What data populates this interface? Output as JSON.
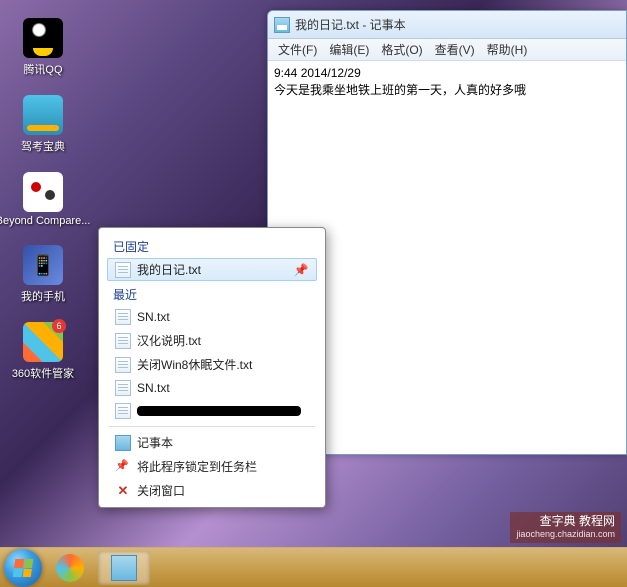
{
  "desktop_icons": [
    {
      "name": "qq",
      "label": "腾讯QQ"
    },
    {
      "name": "jk",
      "label": "驾考宝典"
    },
    {
      "name": "bc",
      "label": "Beyond Compare..."
    },
    {
      "name": "ph",
      "label": "我的手机"
    },
    {
      "name": "sw",
      "label": "360软件管家",
      "badge": "6"
    }
  ],
  "notepad": {
    "title": "我的日记.txt - 记事本",
    "menus": [
      "文件(F)",
      "编辑(E)",
      "格式(O)",
      "查看(V)",
      "帮助(H)"
    ],
    "line1": "9:44 2014/12/29",
    "line2": "今天是我乘坐地铁上班的第一天，人真的好多哦"
  },
  "jumplist": {
    "pinned_hdr": "已固定",
    "pinned": [
      {
        "label": "我的日记.txt"
      }
    ],
    "recent_hdr": "最近",
    "recent": [
      {
        "label": "SN.txt"
      },
      {
        "label": "汉化说明.txt"
      },
      {
        "label": "关闭Win8休眠文件.txt"
      },
      {
        "label": "SN.txt"
      },
      {
        "label": "",
        "redacted": true
      }
    ],
    "tasks": [
      {
        "icon": "notepad",
        "label": "记事本"
      },
      {
        "icon": "pin",
        "label": "将此程序锁定到任务栏"
      },
      {
        "icon": "close",
        "label": "关闭窗口"
      }
    ]
  },
  "watermark": {
    "l1": "查字典 教程网",
    "l2": "jiaocheng.chazidian.com"
  }
}
